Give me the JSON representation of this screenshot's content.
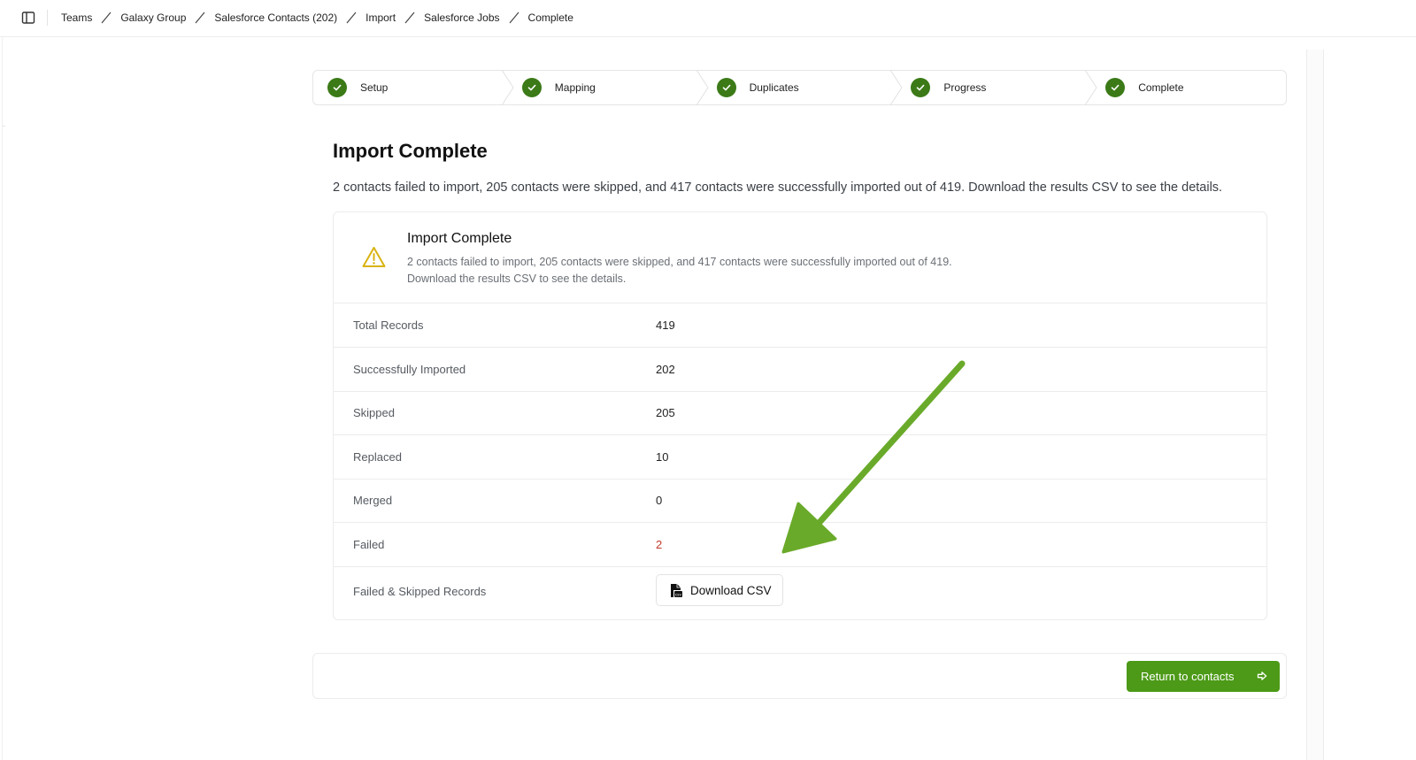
{
  "topbar": {
    "sidebar_toggle_icon": "sidebar-panel-icon",
    "breadcrumb": [
      "Teams",
      "Galaxy Group",
      "Salesforce Contacts (202)",
      "Import",
      "Salesforce Jobs",
      "Complete"
    ]
  },
  "stepper": {
    "steps": [
      {
        "label": "Setup",
        "status": "complete"
      },
      {
        "label": "Mapping",
        "status": "complete"
      },
      {
        "label": "Duplicates",
        "status": "complete"
      },
      {
        "label": "Progress",
        "status": "complete"
      },
      {
        "label": "Complete",
        "status": "complete"
      }
    ],
    "check_color": "#3b7a17"
  },
  "main": {
    "title": "Import Complete",
    "description": "2 contacts failed to import, 205 contacts were skipped, and 417 contacts were successfully imported out of 419. Download the results CSV to see the details."
  },
  "alert": {
    "icon": "warning-triangle-icon",
    "icon_color": "#d9b310",
    "title": "Import Complete",
    "text": "2 contacts failed to import, 205 contacts were skipped, and 417 contacts were successfully imported out of 419. Download the results CSV to see the details."
  },
  "stats": [
    {
      "label": "Total Records",
      "value": "419"
    },
    {
      "label": "Successfully Imported",
      "value": "202"
    },
    {
      "label": "Skipped",
      "value": "205"
    },
    {
      "label": "Replaced",
      "value": "10"
    },
    {
      "label": "Merged",
      "value": "0"
    },
    {
      "label": "Failed",
      "value": "2",
      "color": "#c0392b"
    }
  ],
  "download": {
    "label": "Failed & Skipped Records",
    "button_label": "Download CSV",
    "button_icon": "csv-file-icon"
  },
  "footer": {
    "return_label": "Return to contacts",
    "return_icon": "arrow-right-icon",
    "button_color": "#4c9a17"
  },
  "annotation": {
    "icon": "green-pointer-arrow",
    "color": "#6aaa2a"
  }
}
